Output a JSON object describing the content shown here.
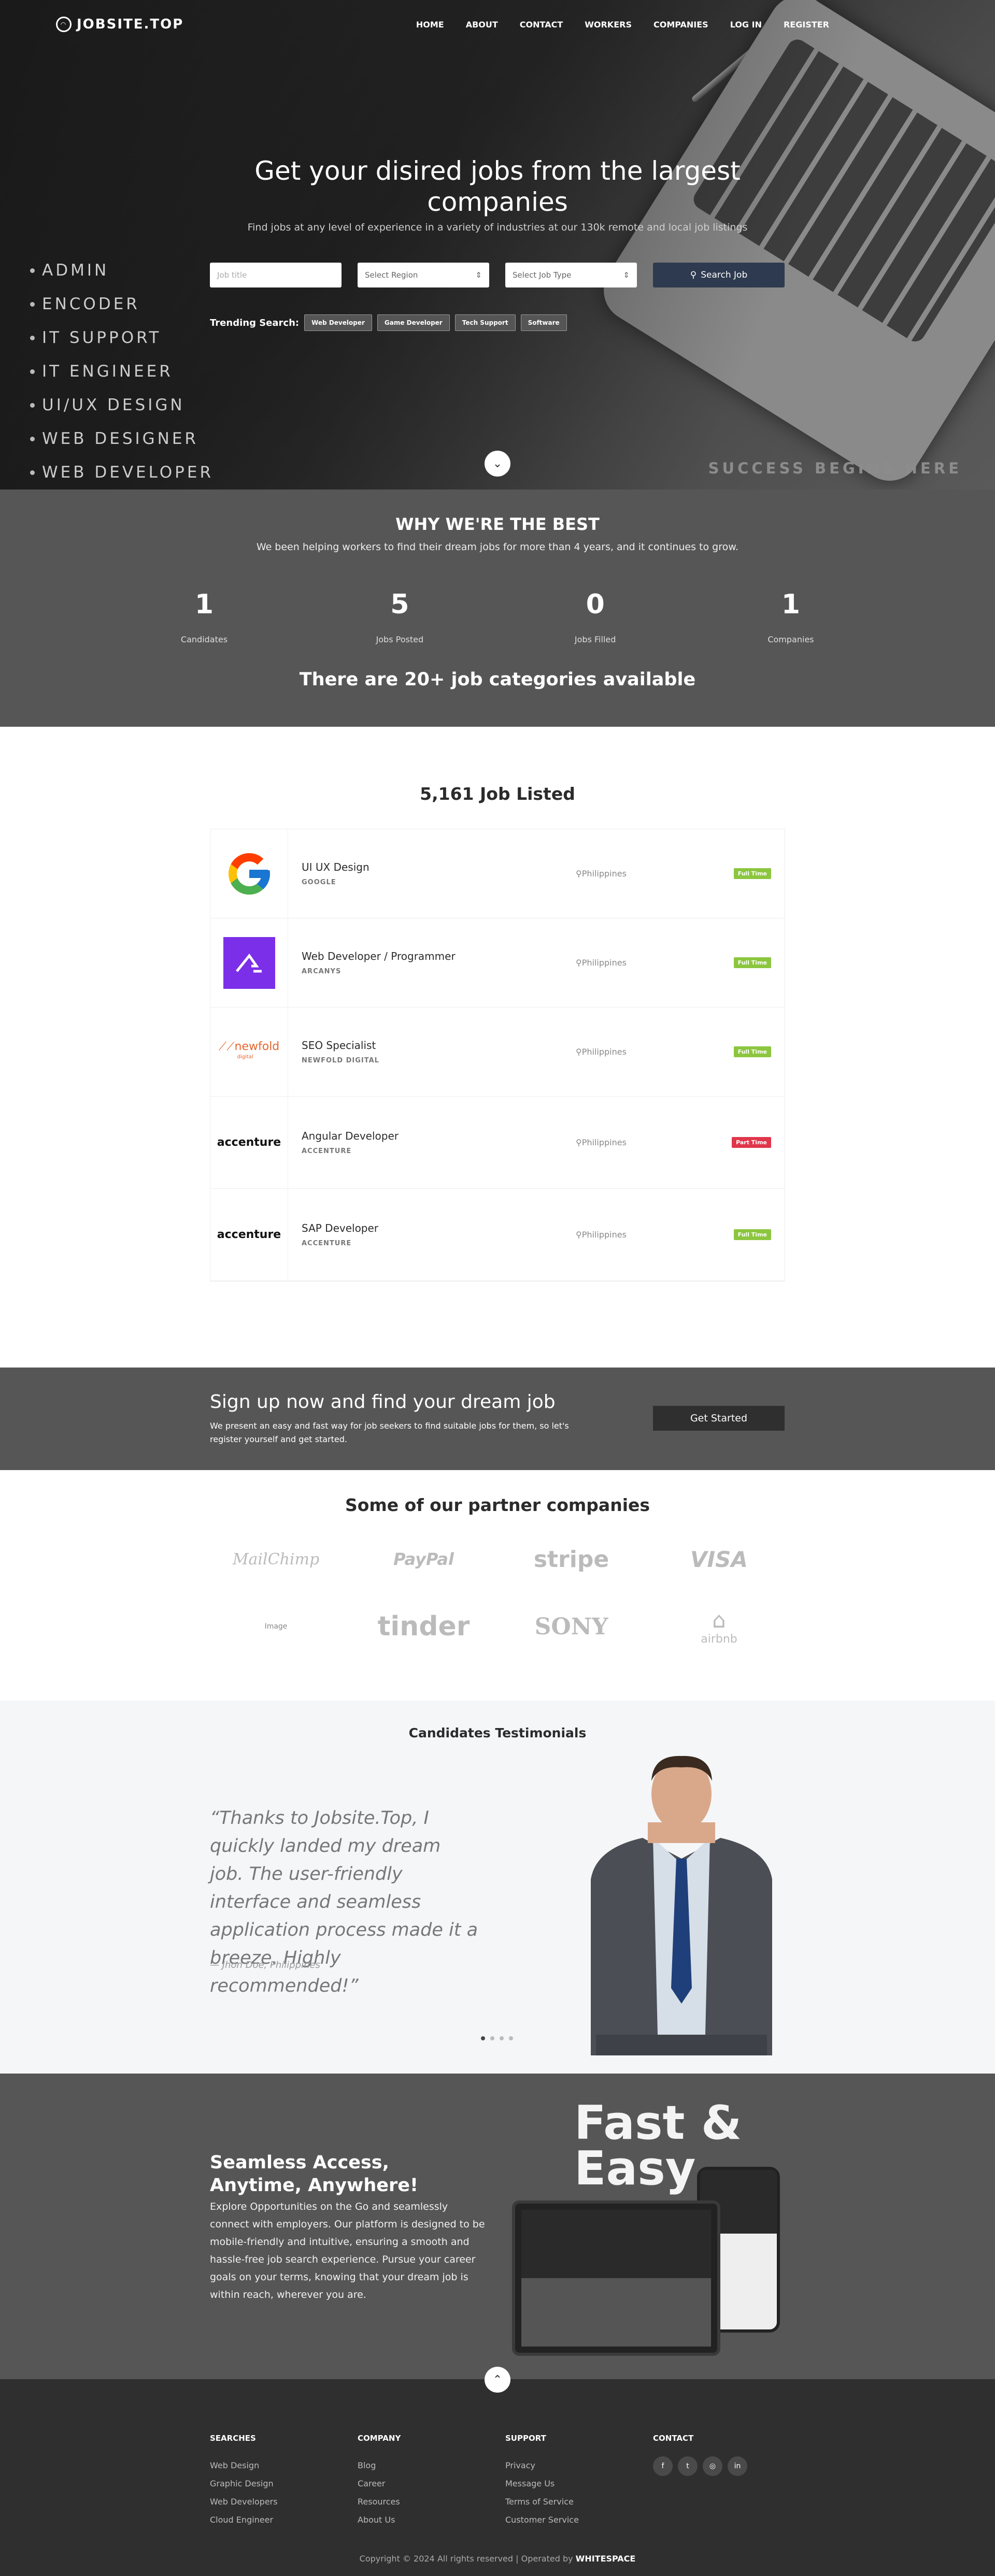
{
  "nav": {
    "logo": "JOBSITE.TOP",
    "items": [
      "HOME",
      "ABOUT",
      "CONTACT",
      "WORKERS",
      "COMPANIES",
      "LOG IN",
      "REGISTER"
    ]
  },
  "hero": {
    "title": "Get your disired jobs from the largest companies",
    "subtitle": "Find jobs at any level of experience in a variety of industries at our 130k remote and local job listings",
    "roles": [
      "ADMIN",
      "ENCODER",
      "IT SUPPORT",
      "IT ENGINEER",
      "UI/UX DESIGN",
      "WEB DESIGNER",
      "WEB DEVELOPER"
    ],
    "search": {
      "job_title_placeholder": "Job title",
      "region": "Select Region",
      "job_type": "Select Job Type",
      "button": "Search Job"
    },
    "trending_label": "Trending Search:",
    "trending": [
      "Web Developer",
      "Game Developer",
      "Tech Support",
      "Software"
    ],
    "tagline": "SUCCESS BEGINS HERE"
  },
  "why": {
    "title": "WHY WE'RE THE BEST",
    "subtitle": "We been helping workers to find their dream jobs for more than 4 years, and it continues to grow.",
    "stats": [
      {
        "value": "1",
        "label": "Candidates"
      },
      {
        "value": "5",
        "label": "Jobs Posted"
      },
      {
        "value": "0",
        "label": "Jobs Filled"
      },
      {
        "value": "1",
        "label": "Companies"
      }
    ],
    "categories": "There are 20+ job categories available"
  },
  "jobs": {
    "heading": "5,161 Job Listed",
    "list": [
      {
        "title": "UI UX Design",
        "company": "GOOGLE",
        "location": "Philippines",
        "type": "Full Time"
      },
      {
        "title": "Web Developer / Programmer",
        "company": "ARCANYS",
        "location": "Philippines",
        "type": "Full Time"
      },
      {
        "title": "SEO Specialist",
        "company": "NEWFOLD DIGITAL",
        "location": "Philippines",
        "type": "Full Time"
      },
      {
        "title": "Angular Developer",
        "company": "ACCENTURE",
        "location": "Philippines",
        "type": "Part Time"
      },
      {
        "title": "SAP Developer",
        "company": "ACCENTURE",
        "location": "Philippines",
        "type": "Full Time"
      }
    ],
    "logo_texts": {
      "newfold": "newfold",
      "newfold_sub": "digital",
      "accenture": "accenture"
    }
  },
  "signup": {
    "title": "Sign up now and find your dream job",
    "text": "We present an easy and fast way for job seekers to find suitable jobs for them, so let's register yourself and get started.",
    "button": "Get Started"
  },
  "partners": {
    "title": "Some of our partner companies",
    "logos": [
      "MailChimp",
      "PayPal",
      "stripe",
      "VISA",
      "Image",
      "tinder",
      "SONY",
      "airbnb"
    ]
  },
  "testimonials": {
    "title": "Candidates Testimonials",
    "quote": "“Thanks to Jobsite.Top, I quickly landed my dream job. The user-friendly interface and seamless application process made it a breeze. Highly recommended!”",
    "author": "— Jhon Doe, Philippines"
  },
  "mobile": {
    "title": "Seamless Access, Anytime, Anywhere!",
    "text": "Explore Opportunities on the Go and seamlessly connect with employers. Our platform is designed to be mobile-friendly and intuitive, ensuring a smooth and hassle-free job search experience. Pursue your career goals on your terms, knowing that your dream job is within reach, wherever you are.",
    "fast_line1": "Fast &",
    "fast_line2": "Easy"
  },
  "footer": {
    "columns": [
      {
        "title": "SEARCHES",
        "items": [
          "Web Design",
          "Graphic Design",
          "Web Developers",
          "Cloud Engineer"
        ]
      },
      {
        "title": "COMPANY",
        "items": [
          "Blog",
          "Career",
          "Resources",
          "About Us"
        ]
      },
      {
        "title": "SUPPORT",
        "items": [
          "Privacy",
          "Message Us",
          "Terms of Service",
          "Customer Service"
        ]
      }
    ],
    "contact_title": "CONTACT",
    "copyright": "Copyright © 2024 All rights reserved | Operated by",
    "operator": "WHITESPACE"
  },
  "colors": {
    "dark_section": "#565656",
    "navy_button": "#2e3a4f",
    "full_time": "#8cc63f",
    "part_time": "#e0364b"
  }
}
